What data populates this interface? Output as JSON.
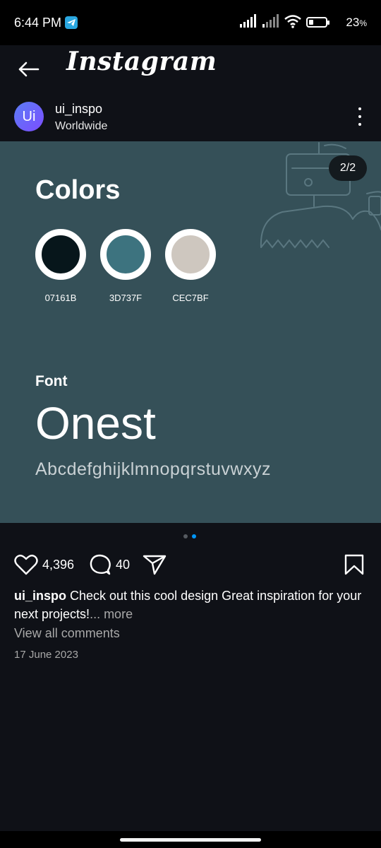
{
  "status_bar": {
    "time": "6:44 PM",
    "battery_percent": "23",
    "battery_suffix": "%",
    "icons": [
      "telegram-icon",
      "signal-icon",
      "signal-icon",
      "wifi-icon",
      "battery-icon"
    ]
  },
  "header": {
    "title": "Instagram",
    "back_icon": "back-arrow-icon"
  },
  "post": {
    "avatar_text": "Ui",
    "username": "ui_inspo",
    "location": "Worldwide",
    "image": {
      "counter": "2/2",
      "colors_title": "Colors",
      "swatches": [
        {
          "label": "07161B",
          "color": "#07161B"
        },
        {
          "label": "3D737F",
          "color": "#3D737F"
        },
        {
          "label": "CEC7BF",
          "color": "#CEC7BF"
        }
      ],
      "font_label": "Font",
      "font_name": "Onest",
      "alphabet": "Abcdefghijklmnopqrstuvwxyz",
      "background_color": "#355058"
    },
    "carousel": {
      "current": 2,
      "total": 2,
      "active_color": "#0095f6"
    },
    "likes": "4,396",
    "comments_count": "40",
    "caption_user": "ui_inspo",
    "caption_text": " Check out this cool design Great inspiration for your next projects!",
    "caption_more": "... more",
    "view_comments": "View all comments",
    "date": "17 June 2023"
  }
}
